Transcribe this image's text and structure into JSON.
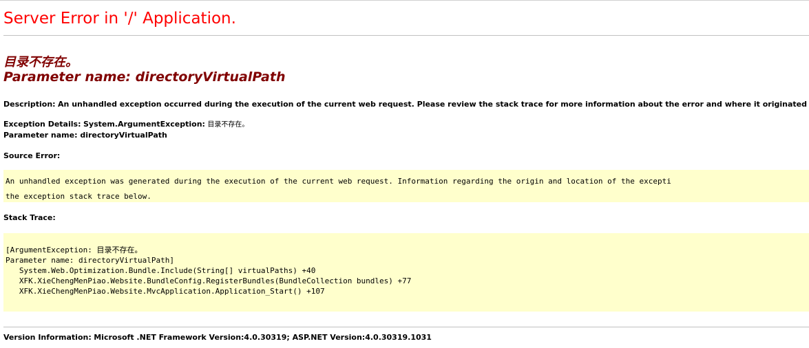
{
  "title": "Server Error in '/' Application.",
  "error_message": {
    "line1": "目录不存在。",
    "line2": "Parameter name: directoryVirtualPath"
  },
  "description": {
    "label": "Description:",
    "text": "An unhandled exception occurred during the execution of the current web request. Please review the stack trace for more information about the error and where it originated in the co"
  },
  "exception_details": {
    "label": "Exception Details:",
    "type": "System.ArgumentException:",
    "message": "目录不存在。",
    "param_line": "Parameter name: directoryVirtualPath"
  },
  "source_error": {
    "label": "Source Error:",
    "lines": [
      "An unhandled exception was generated during the execution of the current web request. Information regarding the origin and location of the excepti",
      "the exception stack trace below."
    ]
  },
  "stack_trace": {
    "label": "Stack Trace:",
    "lines": [
      "[ArgumentException: 目录不存在。",
      "Parameter name: directoryVirtualPath]",
      "   System.Web.Optimization.Bundle.Include(String[] virtualPaths) +40",
      "   XFK.XieChengMenPiao.Website.BundleConfig.RegisterBundles(BundleCollection bundles) +77",
      "   XFK.XieChengMenPiao.Website.MvcApplication.Application_Start() +107"
    ]
  },
  "version_info": {
    "label": "Version Information:",
    "text": "Microsoft .NET Framework Version:4.0.30319; ASP.NET Version:4.0.30319.1031"
  },
  "colors": {
    "title": "#ff0000",
    "error_message": "#800000",
    "code_background": "#ffffcc"
  }
}
